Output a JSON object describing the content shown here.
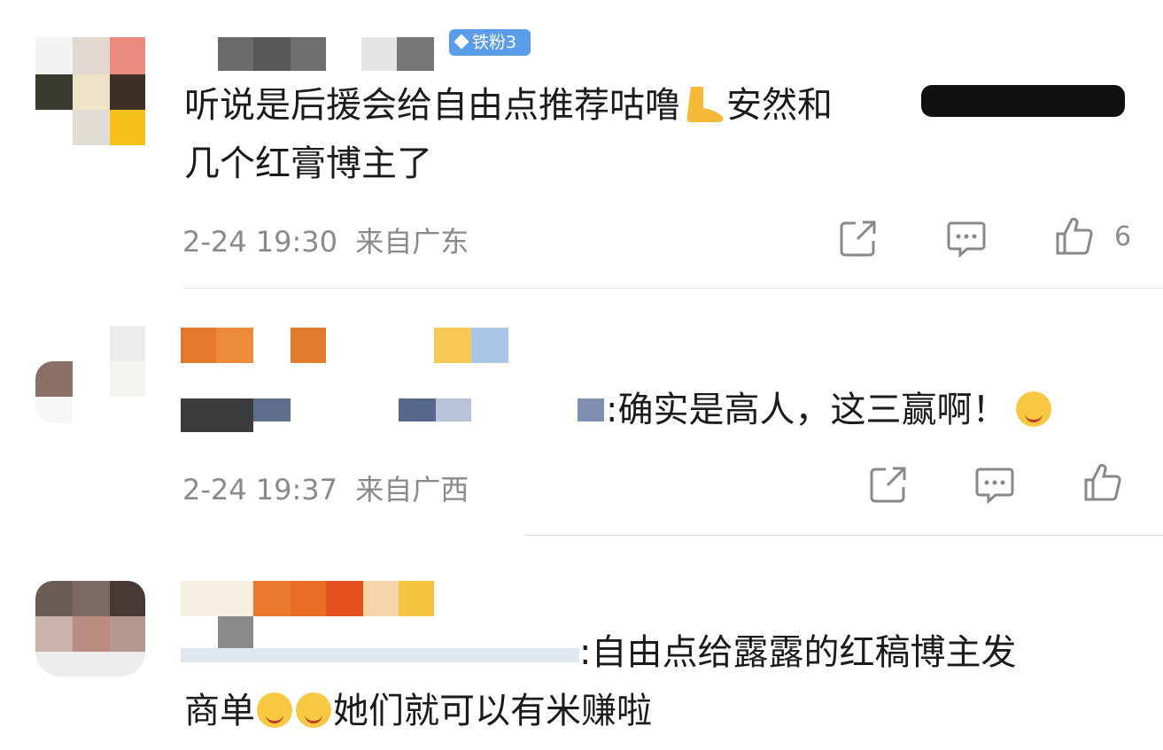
{
  "comments": [
    {
      "badge": "铁粉3",
      "text_line1_a": "听说是后援会给自由点推荐咕噜",
      "text_line1_b": "安然和",
      "text_line2": "几个红膏博主了",
      "time": "2-24 19:30",
      "location": "来自广东",
      "like_count": "6"
    },
    {
      "text": ":确实是高人，这三赢啊！",
      "time": "2-24 19:37",
      "location": "来自广西"
    },
    {
      "text_line1": ":自由点给露露的红稿博主发",
      "text_line2_a": "商单",
      "text_line2_b": "她们就可以有米赚啦"
    }
  ],
  "icons": {
    "share": "share-icon",
    "comment": "comment-icon",
    "like": "like-icon",
    "foot": "foot-emoji-icon",
    "emoji": "emoji-icon"
  },
  "colors": {
    "badge": "#5b9dea",
    "meta_text": "#8a8a8a",
    "body_text": "#1b1b1b",
    "divider": "#e4e4e4"
  }
}
